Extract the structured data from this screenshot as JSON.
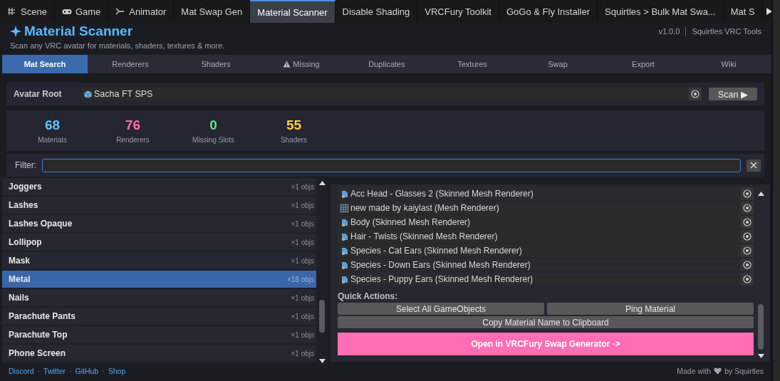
{
  "editor_tabs": [
    {
      "label": "Scene",
      "kind": "scene",
      "selected": false
    },
    {
      "label": "Game",
      "kind": "game",
      "selected": false
    },
    {
      "label": "Animator",
      "kind": "animator",
      "selected": false
    },
    {
      "label": "Mat Swap Gen",
      "selected": false
    },
    {
      "label": "Material Scanner",
      "selected": true
    },
    {
      "label": "Disable Shading",
      "selected": false
    },
    {
      "label": "VRCFury Toolkit",
      "selected": false
    },
    {
      "label": "GoGo & Fly Installer",
      "selected": false
    },
    {
      "label": "Squirtles > Bulk Mat Swa...",
      "selected": false
    },
    {
      "label": "Mat S",
      "selected": false
    }
  ],
  "header": {
    "title": "Material Scanner",
    "subtitle": "Scan any VRC avatar for materials, shaders, textures & more.",
    "version": "v1.0.0",
    "author": "Squirtles VRC Tools"
  },
  "nav_tabs": [
    {
      "label": "Mat Search",
      "selected": true
    },
    {
      "label": "Renderers",
      "selected": false
    },
    {
      "label": "Shaders",
      "selected": false
    },
    {
      "label": "Missing",
      "selected": false,
      "warning": true
    },
    {
      "label": "Duplicates",
      "selected": false
    },
    {
      "label": "Textures",
      "selected": false
    },
    {
      "label": "Swap",
      "selected": false
    },
    {
      "label": "Export",
      "selected": false
    },
    {
      "label": "Wiki",
      "selected": false
    }
  ],
  "avatar_root": {
    "label": "Avatar Root",
    "value": "Sacha FT SPS",
    "button": "Scan ▶"
  },
  "stats": [
    {
      "value": "68",
      "label": "Materials",
      "color": "#5ec3ff"
    },
    {
      "value": "76",
      "label": "Renderers",
      "color": "#ff6fae"
    },
    {
      "value": "0",
      "label": "Missing Slots",
      "color": "#5fe58a"
    },
    {
      "value": "55",
      "label": "Shaders",
      "color": "#ffcf3a"
    }
  ],
  "filter": {
    "label": "Filter:"
  },
  "materials": [
    {
      "name": "Joggers",
      "count": "×1 objs",
      "selected": false
    },
    {
      "name": "Lashes",
      "count": "×1 objs",
      "selected": false
    },
    {
      "name": "Lashes Opaque",
      "count": "×1 objs",
      "selected": false
    },
    {
      "name": "Lollipop",
      "count": "×1 objs",
      "selected": false
    },
    {
      "name": "Mask",
      "count": "×1 objs",
      "selected": false
    },
    {
      "name": "Metal",
      "count": "×18 objs",
      "selected": true
    },
    {
      "name": "Nails",
      "count": "×1 objs",
      "selected": false
    },
    {
      "name": "Parachute Pants",
      "count": "×1 objs",
      "selected": false
    },
    {
      "name": "Parachute Top",
      "count": "×1 objs",
      "selected": false
    },
    {
      "name": "Phone Screen",
      "count": "×1 objs",
      "selected": false
    }
  ],
  "renderers": [
    {
      "label": "Acc Head - Glasses 2 (Skinned Mesh Renderer)",
      "kind": "skinned"
    },
    {
      "label": "new made by kaiylast (Mesh Renderer)",
      "kind": "mesh"
    },
    {
      "label": "Body (Skinned Mesh Renderer)",
      "kind": "skinned"
    },
    {
      "label": "Hair - Twists (Skinned Mesh Renderer)",
      "kind": "skinned"
    },
    {
      "label": "Species - Cat Ears (Skinned Mesh Renderer)",
      "kind": "skinned"
    },
    {
      "label": "Species - Down Ears (Skinned Mesh Renderer)",
      "kind": "skinned"
    },
    {
      "label": "Species - Puppy Ears (Skinned Mesh Renderer)",
      "kind": "skinned"
    }
  ],
  "quick_actions": {
    "title": "Quick Actions:",
    "buttons": [
      "Select All GameObjects",
      "Ping Material",
      "Copy Material Name to Clipboard"
    ],
    "primary": "Open in VRCFury Swap Generator ->"
  },
  "footer": {
    "links": [
      "Discord",
      "Twitter",
      "GitHub",
      "Shop"
    ],
    "separator": "·",
    "credit_before": "Made with",
    "credit_after": "by Squirtles"
  }
}
